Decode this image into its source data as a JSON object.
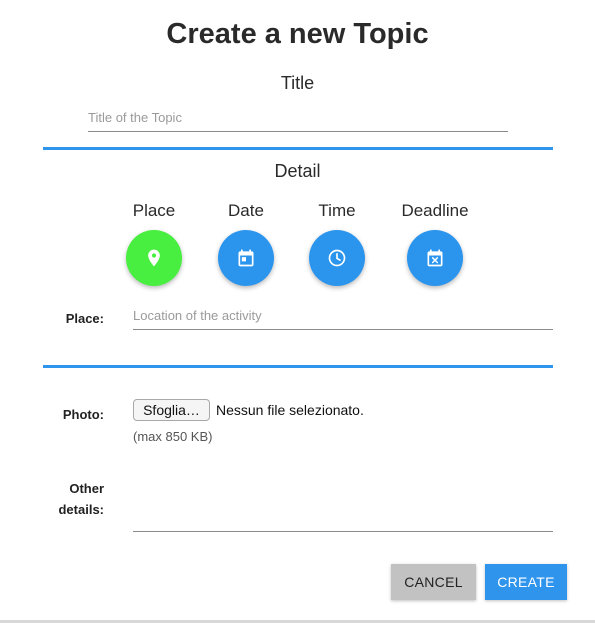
{
  "dialog": {
    "title": "Create a new Topic"
  },
  "title_section": {
    "heading": "Title",
    "input_placeholder": "Title of the Topic",
    "input_value": ""
  },
  "detail_section": {
    "heading": "Detail",
    "options": [
      {
        "label": "Place",
        "icon": "location-pin-icon",
        "selected": true
      },
      {
        "label": "Date",
        "icon": "calendar-icon",
        "selected": false
      },
      {
        "label": "Time",
        "icon": "clock-icon",
        "selected": false
      },
      {
        "label": "Deadline",
        "icon": "calendar-x-icon",
        "selected": false
      }
    ],
    "place_field": {
      "label": "Place:",
      "placeholder": "Location of the activity",
      "value": ""
    }
  },
  "photo_section": {
    "label": "Photo:",
    "browse_button": "Sfoglia…",
    "file_status": "Nessun file selezionato.",
    "size_hint": "(max 850 KB)"
  },
  "other_details": {
    "label_line1": "Other",
    "label_line2": "details:",
    "value": ""
  },
  "actions": {
    "cancel": "CANCEL",
    "create": "CREATE"
  },
  "colors": {
    "accent_blue": "#2f94ec",
    "selected_green": "#48ee40",
    "cancel_gray": "#c2c2c2"
  }
}
